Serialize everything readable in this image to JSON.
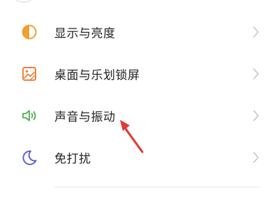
{
  "settings": {
    "items": [
      {
        "label": "显示与亮度",
        "icon": "display-brightness-icon",
        "color": "#f0a030"
      },
      {
        "label": "桌面与乐划锁屏",
        "icon": "wallpaper-icon",
        "color": "#ef7f3b"
      },
      {
        "label": "声音与振动",
        "icon": "speaker-sound-icon",
        "color": "#4caf50"
      },
      {
        "label": "免打扰",
        "icon": "moon-icon",
        "color": "#5b5bd6"
      }
    ]
  },
  "annotation": {
    "arrow_color": "#e53935"
  }
}
